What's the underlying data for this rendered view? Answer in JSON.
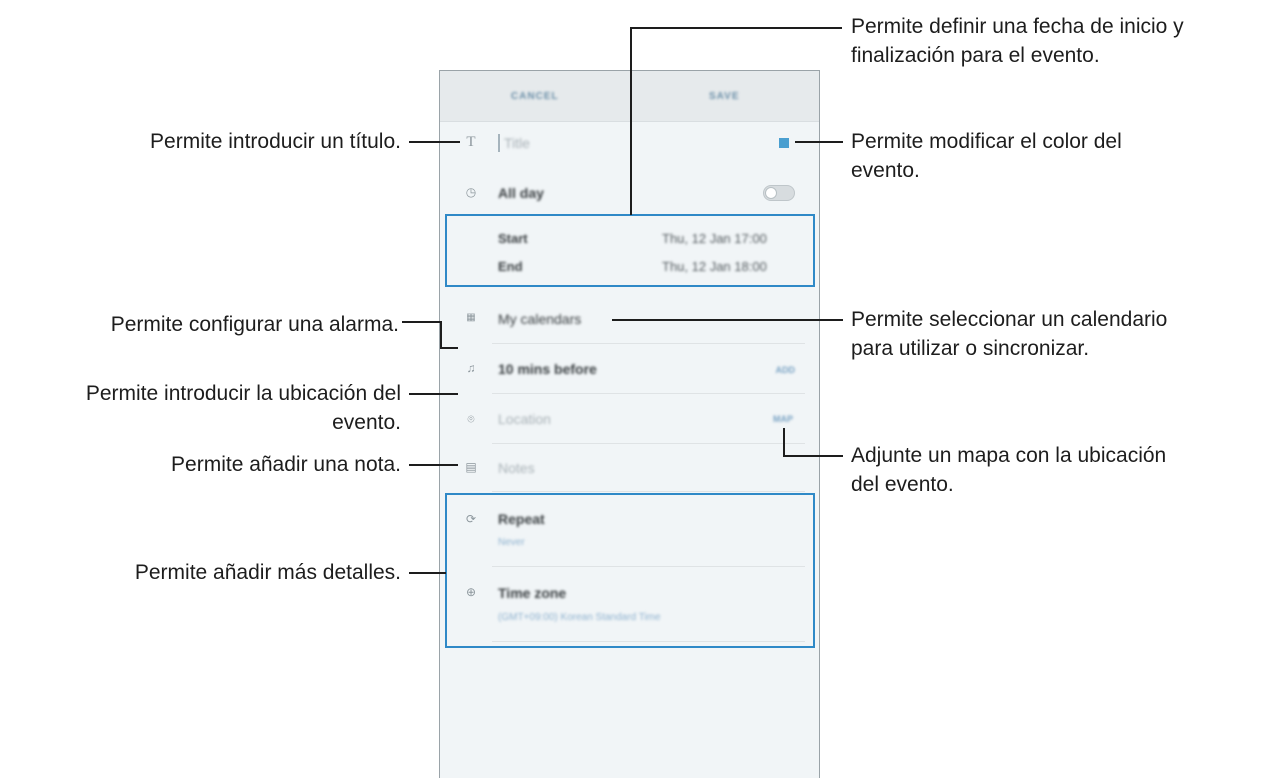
{
  "phone": {
    "cancel_label": "CANCEL",
    "save_label": "SAVE",
    "title_placeholder": "Title",
    "all_day_label": "All day",
    "start_label": "Start",
    "start_value": "Thu, 12 Jan 17:00",
    "end_label": "End",
    "end_value": "Thu, 12 Jan 18:00",
    "calendar_label": "My calendars",
    "alarm_label": "10 mins before",
    "alarm_add": "ADD",
    "location_placeholder": "Location",
    "map_label": "MAP",
    "notes_placeholder": "Notes",
    "repeat_label": "Repeat",
    "repeat_value": "Never",
    "timezone_label": "Time zone",
    "timezone_value": "(GMT+09:00) Korean Standard Time",
    "event_color": "#4a9fd0",
    "highlight_color": "#2f89c7"
  },
  "annotations": {
    "title": "Permite introducir un título.",
    "dates_line1": "Permite definir una fecha de inicio y",
    "dates_line2": "finalización para el evento.",
    "color_line1": "Permite modificar el color del",
    "color_line2": "evento.",
    "alarm": "Permite configurar una alarma.",
    "location_line1": "Permite introducir la ubicación del",
    "location_line2": "evento.",
    "note": "Permite añadir una nota.",
    "calendar_line1": "Permite seleccionar un calendario",
    "calendar_line2": "para utilizar o sincronizar.",
    "map_line1": "Adjunte un mapa con la ubicación",
    "map_line2": "del evento.",
    "details": "Permite añadir más detalles."
  }
}
